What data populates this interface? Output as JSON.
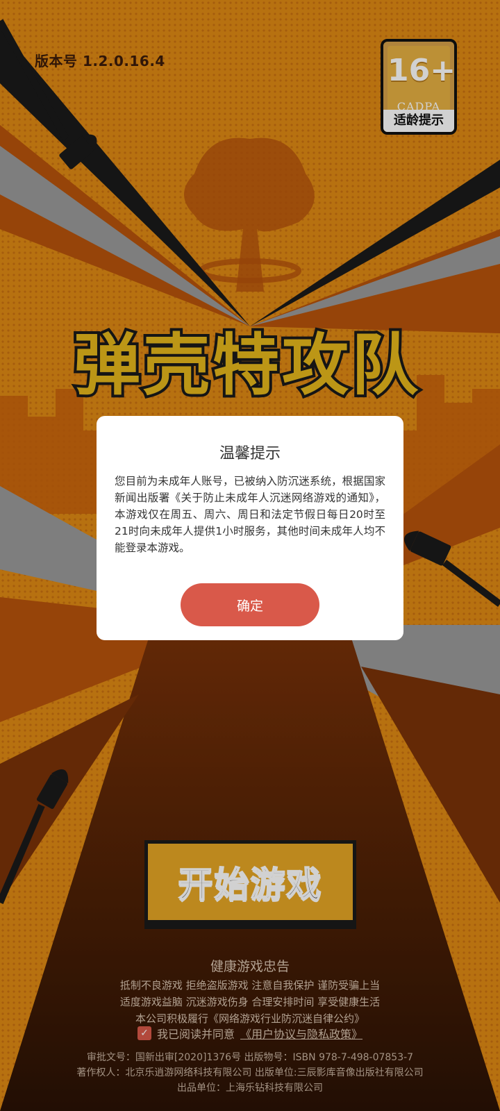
{
  "version_text": "版本号 1.2.0.16.4",
  "age_rating": {
    "number": "16+",
    "org": "CADPA",
    "label": "适龄提示"
  },
  "game_title": "弹壳特攻队",
  "start_button_label": "开始游戏",
  "dialog": {
    "title": "温馨提示",
    "body": "您目前为未成年人账号，已被纳入防沉迷系统，根据国家新闻出版署《关于防止未成年人沉迷网络游戏的通知》，本游戏仅在周五、周六、周日和法定节假日每日20时至21时向未成年人提供1小时服务，其他时间未成年人均不能登录本游戏。",
    "confirm_label": "确定"
  },
  "health_advice": {
    "title": "健康游戏忠告",
    "line1": "抵制不良游戏 拒绝盗版游戏 注意自我保护 谨防受骗上当",
    "line2": "适度游戏益脑 沉迷游戏伤身 合理安排时间 享受健康生活",
    "line3": "本公司积极履行《网络游戏行业防沉迷自律公约》"
  },
  "agreement": {
    "checked": true,
    "prefix": "我已阅读并同意",
    "link": "《用户协议与隐私政策》"
  },
  "publisher_info": {
    "line1": "审批文号：国新出审[2020]1376号 出版物号：ISBN 978-7-498-07853-7",
    "line2": "著作权人：北京乐逍游网络科技有限公司 出版单位:三辰影库音像出版社有限公司",
    "line3": "出品单位：上海乐钻科技有限公司"
  },
  "colors": {
    "background_orange": "#e08a14",
    "background_dark": "#2a1205",
    "accent_red": "#d9594a"
  }
}
